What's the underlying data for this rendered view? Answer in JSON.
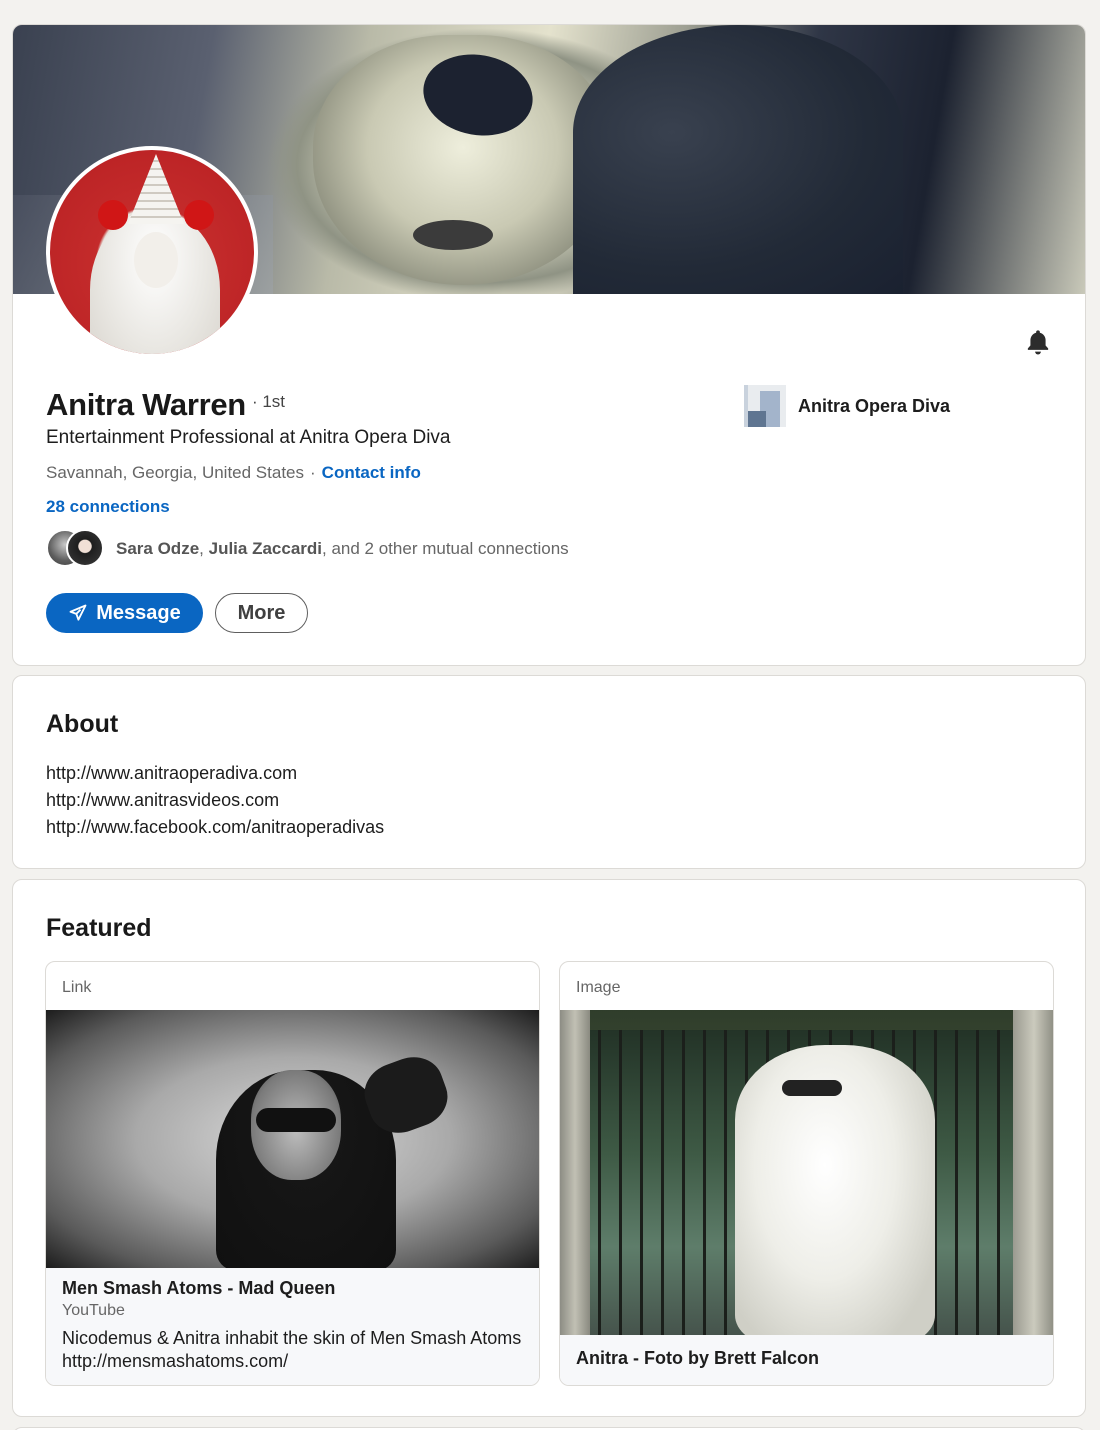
{
  "profile": {
    "name": "Anitra Warren",
    "degree": "· 1st",
    "headline": "Entertainment Professional at Anitra Opera Diva",
    "location": "Savannah, Georgia, United States",
    "separator": "·",
    "contact_info": "Contact info",
    "connections": "28 connections",
    "mutual": {
      "name1": "Sara Odze",
      "comma": ",",
      "name2": "Julia Zaccardi",
      "rest": ", and 2 other mutual connections"
    },
    "company": "Anitra Opera Diva"
  },
  "actions": {
    "message_label": "Message",
    "more_label": "More"
  },
  "about": {
    "title": "About",
    "lines": [
      "http://www.anitraoperadiva.com",
      "http://www.anitrasvideos.com",
      "http://www.facebook.com/anitraoperadivas"
    ]
  },
  "featured": {
    "title": "Featured",
    "items": [
      {
        "type": "Link",
        "title": "Men Smash Atoms - Mad Queen",
        "source": "YouTube",
        "description": "Nicodemus & Anitra inhabit the skin of Men Smash Atoms http://mensmashatoms.com/"
      },
      {
        "type": "Image",
        "title": "Anitra - Foto by Brett Falcon"
      }
    ]
  },
  "colors": {
    "accent": "#0a66c2",
    "background": "#f3f2ef",
    "card": "#ffffff"
  },
  "icons": {
    "notify": "bell-icon",
    "message": "send-icon"
  }
}
